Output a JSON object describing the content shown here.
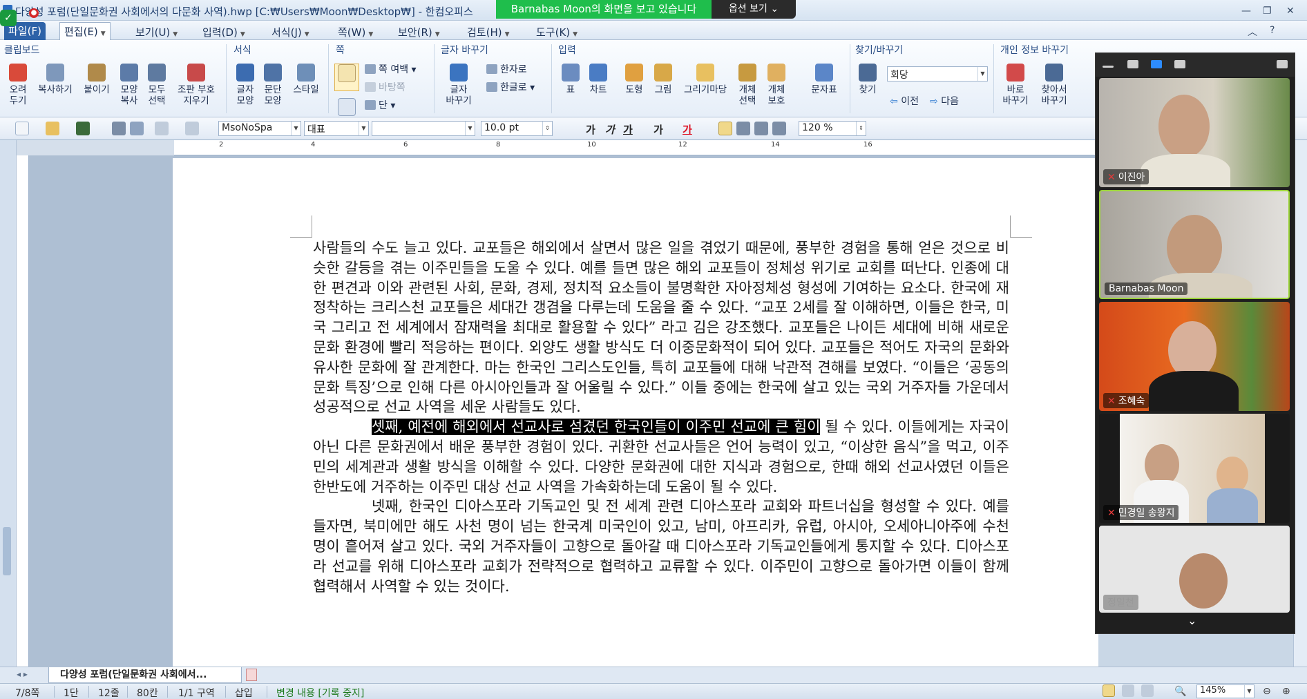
{
  "window": {
    "title": "다양성 포럼(단일문화권 사회에서의 다문화 사역).hwp [C:₩Users₩Moon₩Desktop₩] - 한컴오피스",
    "share_banner": "Barnabas Moon의 화면을 보고 있습니다",
    "share_options": "옵션 보기"
  },
  "menubar": {
    "items": [
      "파일(F)",
      "편집(E)",
      "보기(U)",
      "입력(D)",
      "서식(J)",
      "쪽(W)",
      "보안(R)",
      "검토(H)",
      "도구(K)"
    ]
  },
  "ribbon": {
    "groups": {
      "clipboard": "클립보드",
      "format": "서식",
      "page": "쪽",
      "font_change": "글자 바꾸기",
      "input": "입력",
      "find_replace": "찾기/바꾸기",
      "privacy": "개인 정보 바꾸기"
    },
    "buttons": {
      "cut": "오려\n두기",
      "copy": "복사하기",
      "paste": "붙이기",
      "format_copy": "모양\n복사",
      "select_all": "모두\n선택",
      "hide_changes": "조판 부호\n지우기",
      "char_shape": "글자\n모양",
      "para_shape": "문단\n모양",
      "style": "스타일",
      "page_margin": "쪽 여백",
      "background": "바탕쪽",
      "columns": "단",
      "char_change": "글자\n바꾸기",
      "hanja": "한자로",
      "hangul": "한글로",
      "table": "표",
      "chart": "차트",
      "shape": "도형",
      "picture": "그림",
      "drawing": "그리기마당",
      "object_select": "개체\n선택",
      "object_protect": "개체\n보호",
      "symbol": "문자표",
      "find": "찾기",
      "replace_combo": "회당",
      "prev": "이전",
      "next": "다음",
      "direct_change": "바로\n바꾸기",
      "find_change": "찾아서\n바꾸기"
    }
  },
  "format_toolbar": {
    "style": "MsoNoSpa",
    "lang": "대표",
    "font": "",
    "size": "10.0",
    "size_unit": "pt",
    "bold": "가",
    "italic": "가",
    "underline": "가",
    "strike": "가",
    "color": "가",
    "zoom": "120",
    "zoom_unit": "%"
  },
  "ruler": {
    "numbers": [
      "2",
      "4",
      "6",
      "8",
      "10",
      "12",
      "14",
      "16"
    ]
  },
  "document": {
    "paragraphs": [
      "사람들의 수도 늘고 있다. 교포들은 해외에서 살면서 많은 일을 겪었기 때문에, 풍부한 경험을 통해 얻은 것으로 비슷한 갈등을 겪는 이주민들을 도울 수 있다. 예를 들면 많은 해외 교포들이 정체성 위기로 교회를 떠난다. 인종에 대한 편견과 이와 관련된 사회, 문화, 경제, 정치적 요소들이 불명확한 자아정체성 형성에 기여하는 요소다. 한국에 재정착하는 크리스천 교포들은 세대간 갱겸을 다루는데 도움을 줄 수 있다. “교포 2세를 잘 이해하면, 이들은 한국, 미국 그리고 전 세계에서 잠재력을 최대로 활용할 수 있다” 라고 김은 강조했다. 교포들은 나이든 세대에 비해 새로운 문화 환경에 빨리 적응하는 편이다. 외양도 생활 방식도 더 이중문화적이 되어 있다. 교포들은 적어도 자국의 문화와 유사한 문화에 잘 관계한다. 마는 한국인 그리스도인들, 특히 교포들에 대해 낙관적 견해를 보였다. “이들은 ‘공동의 문화 특징’으로 인해 다른 아시아인들과 잘 어울릴 수 있다.” 이들 중에는 한국에 살고 있는 국외 거주자들 가운데서 성공적으로 선교 사역을 세운 사람들도 있다."
    ],
    "para2_highlight": "셋째, 예전에 해외에서 선교사로 섬겼던 한국인들이 이주민 선교에 큰 힘이",
    "para2_rest": " 될 수 있다. 이들에게는 자국이 아닌 다른 문화권에서 배운 풍부한 경험이 있다. 귀환한 선교사들은 언어 능력이 있고, “이상한 음식”을 먹고, 이주민의 세계관과 생활 방식을 이해할 수 있다. 다양한 문화권에 대한 지식과 경험으로, 한때 해외 선교사였던 이들은 한반도에 거주하는 이주민 대상 선교 사역을 가속화하는데 도움이 될 수 있다.",
    "para3": "넷째, 한국인 디아스포라 기독교인 및 전 세계 관련 디아스포라 교회와 파트너십을 형성할 수 있다. 예를 들자면, 북미에만 해도 사천 명이 넘는 한국계 미국인이 있고, 남미, 아프리카, 유럽, 아시아, 오세아니아주에 수천 명이 흩어져 살고 있다. 국외 거주자들이 고향으로 돌아갈 때 디아스포라 기독교인들에게 통지할 수 있다. 디아스포라 선교를 위해 디아스포라 교회가 전략적으로 협력하고 교류할 수 있다. 이주민이 고향으로 돌아가면 이들이 함께 협력해서 사역할 수 있는 것이다."
  },
  "tabbar": {
    "doc_tab": "다양성 포럼(단일문화권 사회에서..."
  },
  "statusbar": {
    "page": "7/8쪽",
    "column": "1단",
    "line": "12줄",
    "col": "80칸",
    "section": "1/1 구역",
    "mode": "삽입",
    "track": "변경 내용 [기록 중지]",
    "zoom": "145%"
  },
  "zoom": {
    "participants": [
      {
        "name": "이진아",
        "muted": true
      },
      {
        "name": "Barnabas Moon",
        "muted": false
      },
      {
        "name": "조혜숙",
        "muted": true
      },
      {
        "name": "민경일 송왕지",
        "muted": true
      },
      {
        "name": "정일천",
        "muted": false
      }
    ]
  },
  "colors": {
    "share_green": "#1fbe4c",
    "menu_blue": "#2d62a8",
    "ribbon_bg": "#e6eef8",
    "zoom_bg": "#1f1f1f"
  }
}
